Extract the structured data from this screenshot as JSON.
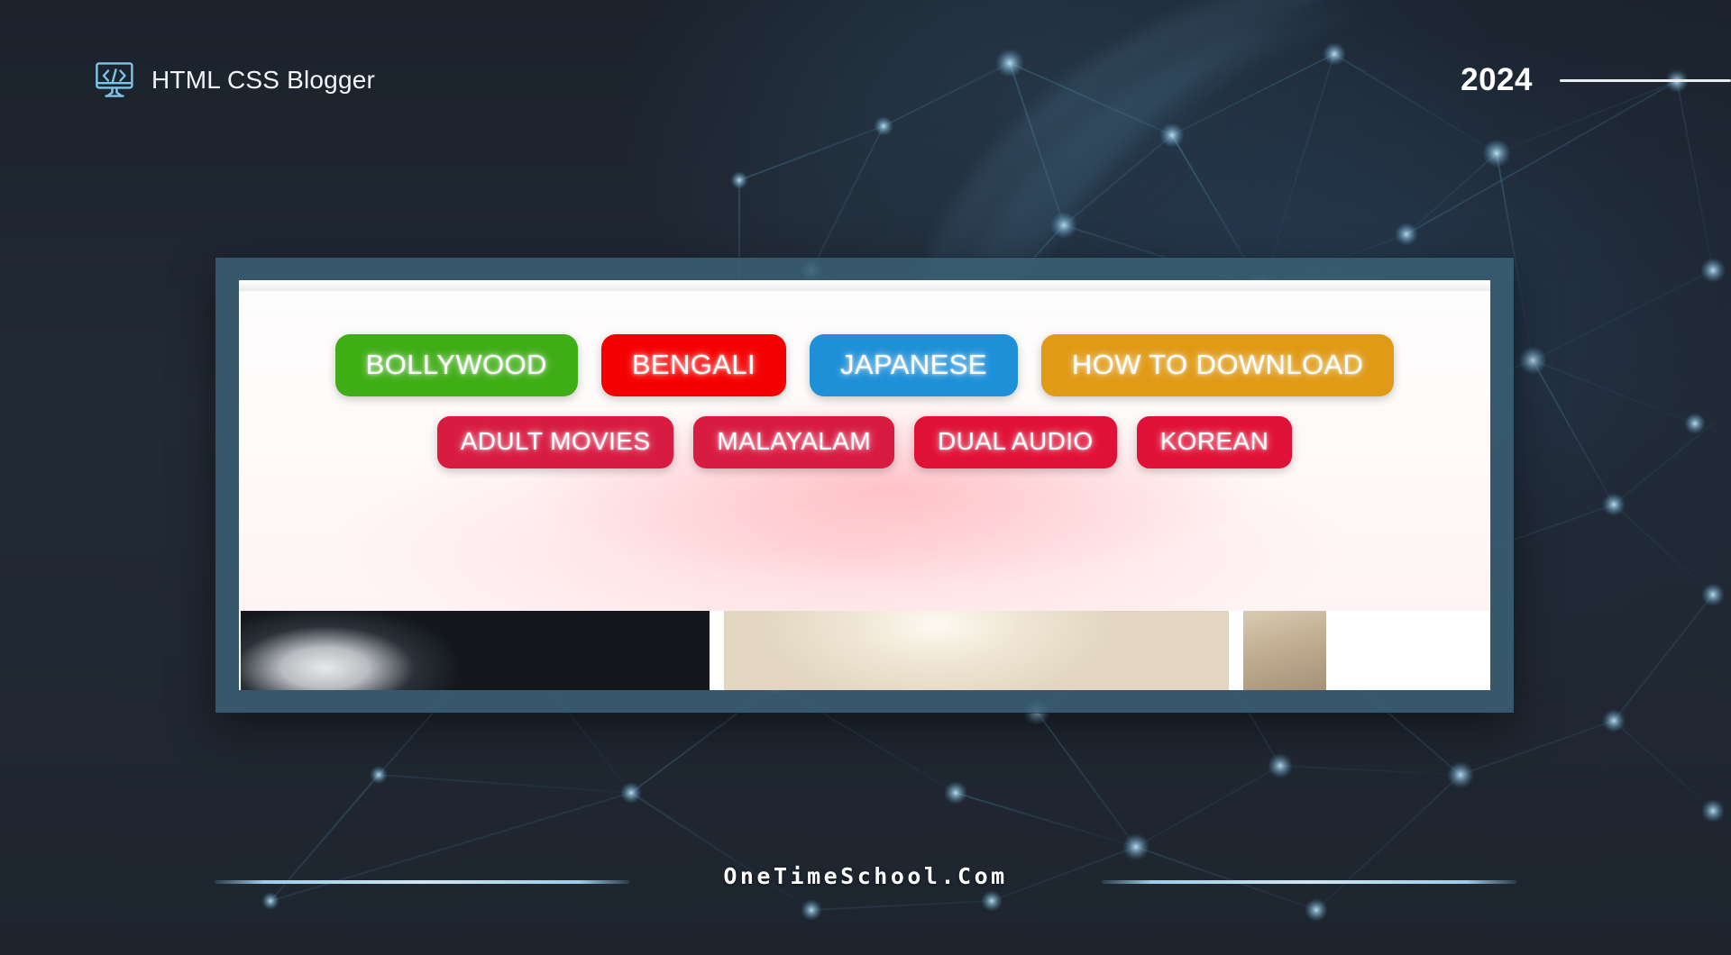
{
  "header": {
    "brand_name": "HTML CSS Blogger",
    "brand_icon": "code-monitor-icon",
    "year": "2024"
  },
  "card": {
    "frame_color": "#3a5e73",
    "inner_background": "#ffffff",
    "glow_color": "#ff96a0",
    "button_rows": [
      {
        "row": 1,
        "buttons": [
          {
            "label": "BOLLYWOOD",
            "color": "#3fad16"
          },
          {
            "label": "BENGALI",
            "color": "#f50000"
          },
          {
            "label": "JAPANESE",
            "color": "#1e90d8"
          },
          {
            "label": "HOW TO DOWNLOAD",
            "color": "#e09a16"
          }
        ]
      },
      {
        "row": 2,
        "buttons": [
          {
            "label": "ADULT MOVIES",
            "color": "#d81b41"
          },
          {
            "label": "MALAYALAM",
            "color": "#d81b41"
          },
          {
            "label": "DUAL AUDIO",
            "color": "#e01136"
          },
          {
            "label": "KOREAN",
            "color": "#e01136"
          }
        ]
      }
    ],
    "thumbnails": [
      {
        "name": "thumbnail-dark-movie-still"
      },
      {
        "name": "thumbnail-cream-sky"
      },
      {
        "name": "thumbnail-sand-texture"
      }
    ]
  },
  "footer": {
    "site_name": "OneTimeSchool.Com",
    "rule_color": "#9ecbe6"
  },
  "theme": {
    "background": "#222a36",
    "accent": "#7fc4e8"
  }
}
